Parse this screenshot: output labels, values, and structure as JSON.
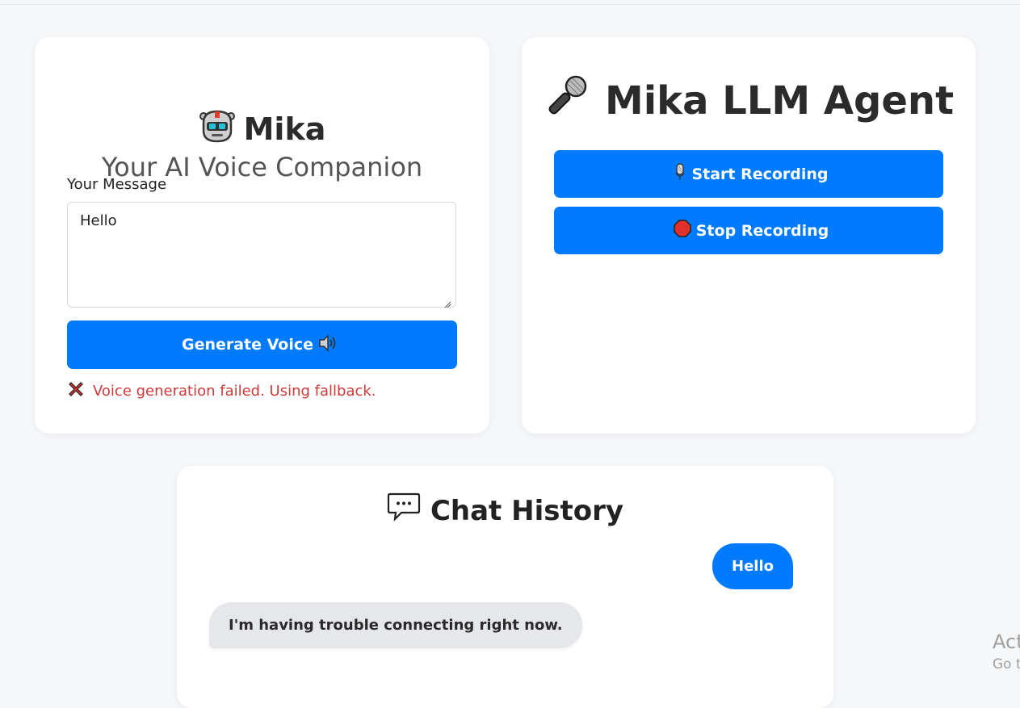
{
  "left_card": {
    "title": "Mika",
    "tagline": "Your AI Voice Companion",
    "message_label": "Your Message",
    "message_value": "Hello",
    "generate_button": "Generate Voice",
    "error_text": "Voice generation failed. Using fallback."
  },
  "right_card": {
    "title": "Mika LLM Agent",
    "start_button": "Start Recording",
    "stop_button": "Stop Recording"
  },
  "chat": {
    "title": "Chat History",
    "messages": [
      {
        "role": "user",
        "text": "Hello"
      },
      {
        "role": "assistant",
        "text": "I'm having trouble connecting right now."
      }
    ]
  },
  "watermark": {
    "line1": "Act",
    "line2": "Go t"
  },
  "colors": {
    "accent": "#007bff",
    "error": "#d03a3a",
    "background": "#f6f7f9",
    "bot_bubble": "#e6e7ea"
  },
  "icons": {
    "brand": "robot-icon",
    "generate": "speaker-icon",
    "error": "cross-icon",
    "agent": "microphone-icon",
    "start": "microphone-small-icon",
    "stop": "stop-sign-icon",
    "chat": "speech-bubble-icon"
  }
}
